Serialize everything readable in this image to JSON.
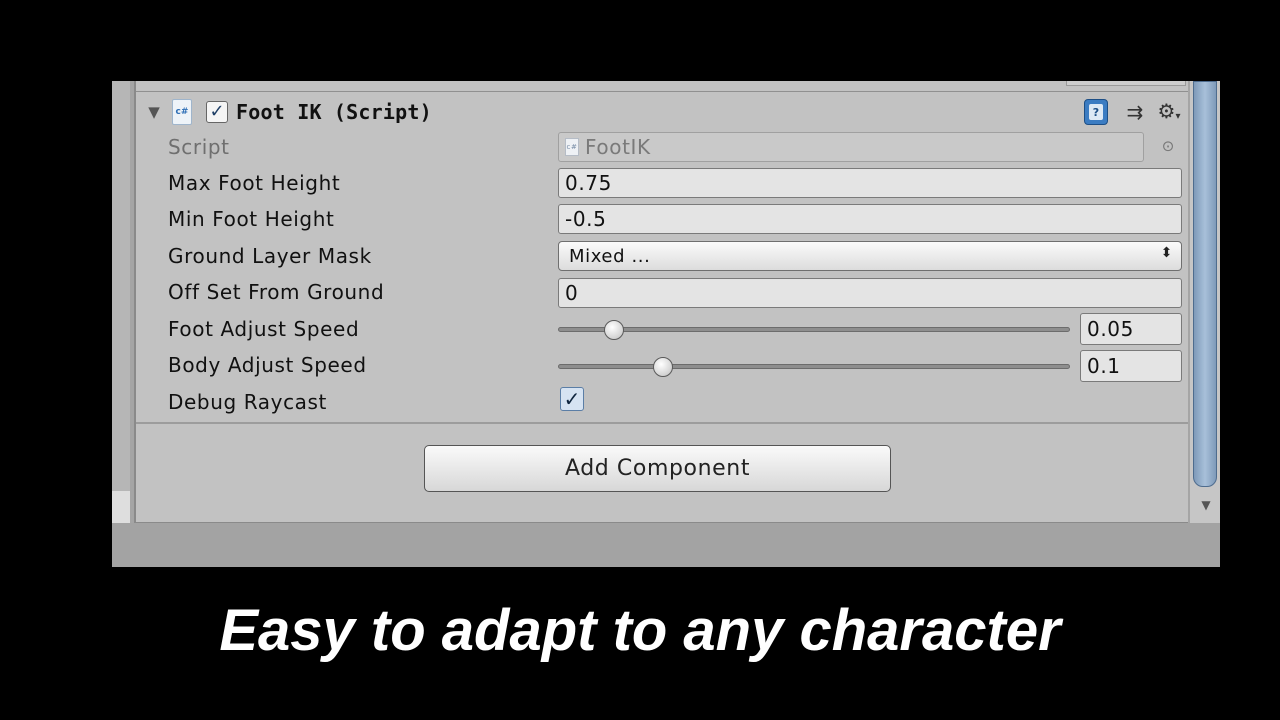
{
  "component": {
    "title": "Foot IK (Script)",
    "enabled": true,
    "icons": {
      "foldout": "foldout-triangle-icon",
      "script_type": "csharp-script-icon",
      "script_type_text": "c#",
      "help": "help-book-icon",
      "presets": "presets-sliders-icon",
      "settings": "gear-menu-icon"
    }
  },
  "fields": {
    "script": {
      "label": "Script",
      "value": "FootIK"
    },
    "max_foot_height": {
      "label": "Max Foot Height",
      "value": "0.75"
    },
    "min_foot_height": {
      "label": "Min Foot Height",
      "value": "-0.5"
    },
    "ground_layer_mask": {
      "label": "Ground Layer Mask",
      "value": "Mixed ..."
    },
    "offset_from_ground": {
      "label": "Off Set From Ground",
      "value": "0"
    },
    "foot_adjust_speed": {
      "label": "Foot Adjust Speed",
      "value": "0.05",
      "slider_fraction": 0.11
    },
    "body_adjust_speed": {
      "label": "Body Adjust Speed",
      "value": "0.1",
      "slider_fraction": 0.205
    },
    "debug_raycast": {
      "label": "Debug Raycast",
      "checked": true
    }
  },
  "add_component_label": "Add Component",
  "caption": "Easy to adapt to any character",
  "colors": {
    "inspector_bg": "#c2c2c2",
    "scrollbar": "#8fa9c6",
    "caption_text": "#ffffff",
    "background": "#000000"
  }
}
